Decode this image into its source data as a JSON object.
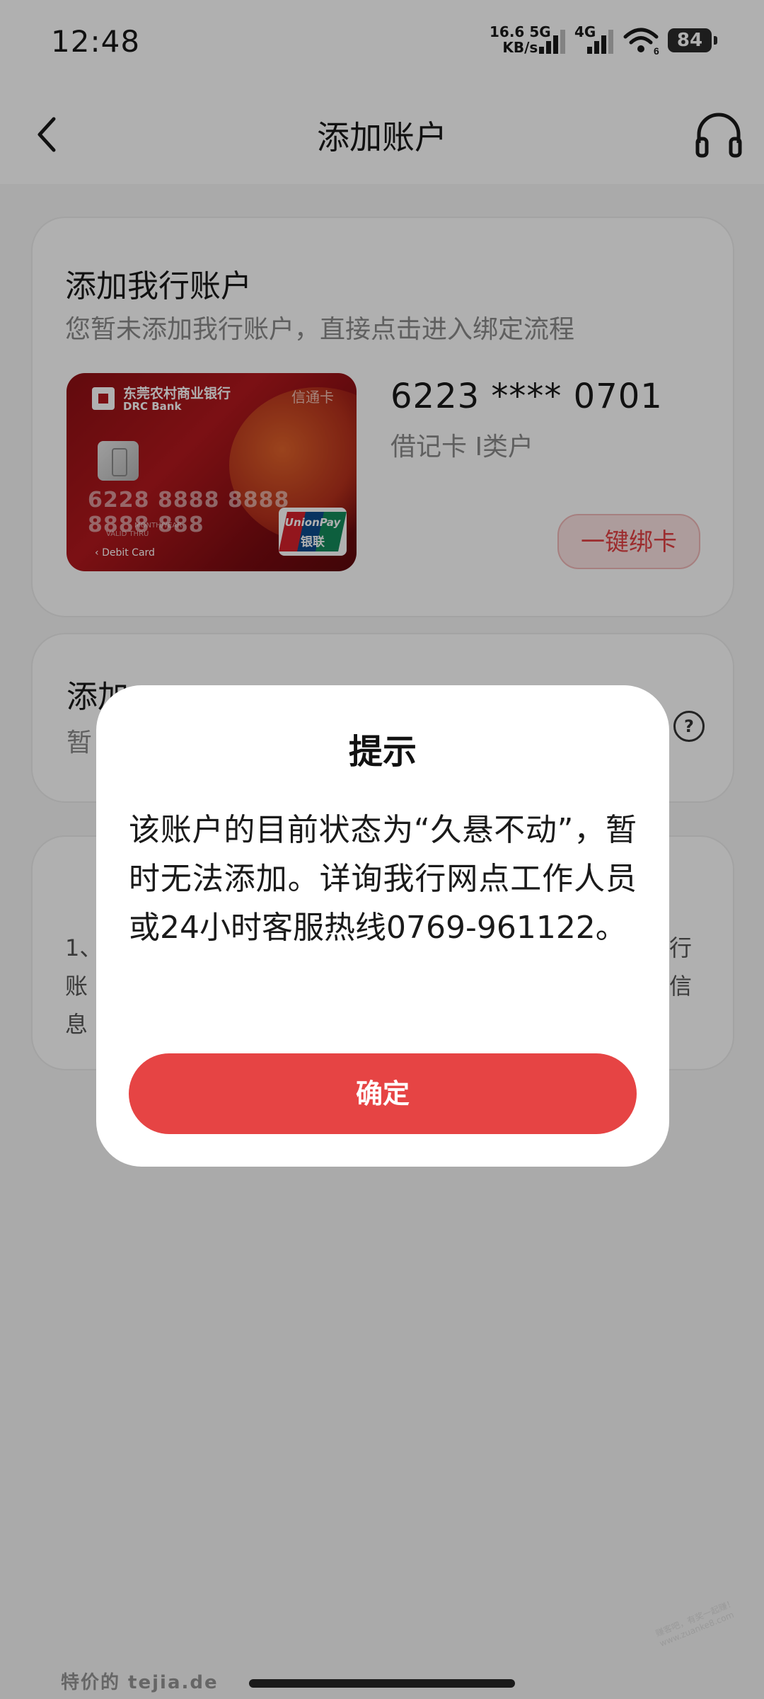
{
  "status_bar": {
    "time": "12:48",
    "speed_value": "16.6",
    "speed_unit": "KB/s",
    "net1": "5G",
    "net2": "4G",
    "wifi_sub": "6",
    "battery": "84"
  },
  "header": {
    "title": "添加账户"
  },
  "own_bank_section": {
    "title": "添加我行账户",
    "subtitle": "您暂未添加我行账户，直接点击进入绑定流程",
    "card_image": {
      "bank_name": "东莞农村商业银行",
      "bank_en": "DRC Bank",
      "card_brand": "信通卡",
      "sample_number": "6228 8888 8888 8888 888",
      "valid_label": "MONTH/YEAR",
      "valid_thru": "VALID THRU",
      "debit_label": "Debit Card",
      "unionpay_en": "UnionPay",
      "unionpay_cn": "银联"
    },
    "account_number": "6223 **** 0701",
    "account_type": "借记卡 I类户",
    "bind_button": "一键绑卡"
  },
  "other_bank_section": {
    "title": "添加",
    "subtitle": "暂"
  },
  "notes": {
    "line1_left": "1、",
    "line1_right": "行",
    "line2_left": "账",
    "line2_right": "信",
    "line3_left": "息"
  },
  "dialog": {
    "title": "提示",
    "message": "该账户的目前状态为“久悬不动”，暂时无法添加。详询我行网点工作人员或24小时客服热线0769-961122。",
    "confirm_button": "确定"
  },
  "watermark": {
    "left": "特价的 tejia.de",
    "corner": "赚客吧，有奖一起赚！ www.zuanke8.com"
  },
  "colors": {
    "accent": "#e64444",
    "bind_button_bg": "#fbe3e3",
    "card_red": "#b3181d"
  },
  "icons": {
    "back": "chevron-left-icon",
    "support": "headset-icon",
    "help": "question-circle-icon"
  }
}
